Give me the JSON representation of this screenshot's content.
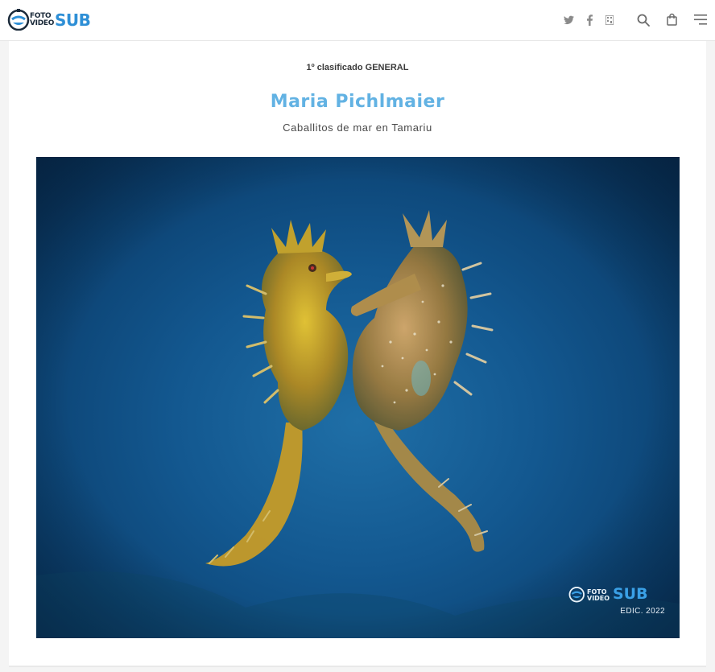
{
  "header": {
    "logo": {
      "line1": "FOTO",
      "line2": "VIDEO",
      "big": "SUB",
      "brand_color": "#2e8fd6"
    },
    "icons": [
      "twitter-icon",
      "facebook-icon",
      "qr-code-icon",
      "search-icon",
      "shopping-bag-icon",
      "menu-icon"
    ]
  },
  "entry": {
    "category": "1º clasificado GENERAL",
    "author": "Maria Pichlmaier",
    "photo_title": "Caballitos de mar en Tamariu",
    "author_color": "#62b2e3"
  },
  "watermark": {
    "line1": "FOTO",
    "line2": "VIDEO",
    "big": "SUB",
    "edition": "EDIC. 2022"
  }
}
